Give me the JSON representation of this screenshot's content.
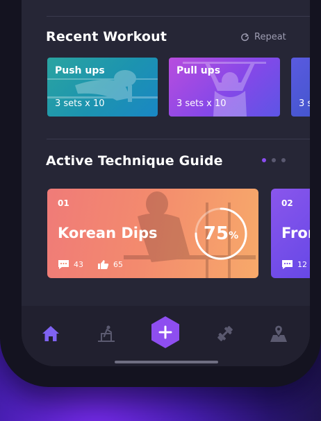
{
  "recent": {
    "title": "Recent Workout",
    "repeat_label": "Repeat",
    "cards": [
      {
        "name": "Push ups",
        "sets": "3 sets x 10"
      },
      {
        "name": "Pull ups",
        "sets": "3 sets x 10"
      },
      {
        "name": "",
        "sets": "3 s"
      }
    ]
  },
  "technique": {
    "title": "Active Technique Guide",
    "pager_count": 3,
    "pager_active": 0,
    "cards": [
      {
        "number": "01",
        "name": "Korean Dips",
        "progress_value": "75",
        "progress_unit": "%",
        "comments": "43",
        "likes": "65"
      },
      {
        "number": "02",
        "name": "Fron",
        "comments": "12"
      }
    ]
  },
  "nav": {
    "items": [
      "home-icon",
      "technique-icon",
      "add-icon",
      "dumbbell-icon",
      "map-icon"
    ],
    "active": "home"
  },
  "colors": {
    "accent": "#8a4cf0",
    "nav_active": "#7f63f2",
    "add_button": "#8e4ef0",
    "card_teal": "#1c93b0",
    "card_purple": "#8548e8",
    "card_orange": "#f38a6e"
  }
}
